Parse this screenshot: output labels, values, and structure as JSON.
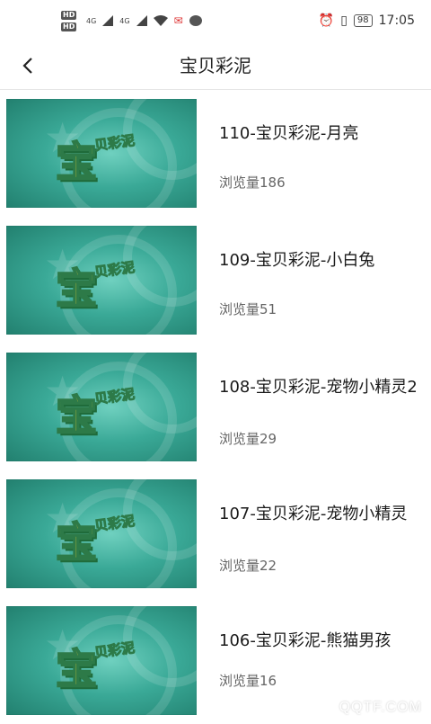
{
  "status_bar": {
    "hd1": "HD",
    "hd2": "HD",
    "net1": "4G",
    "net2": "4G",
    "battery": "98",
    "time": "17:05"
  },
  "header": {
    "title": "宝贝彩泥"
  },
  "thumbnail": {
    "logo_main": "宝",
    "logo_sub": "贝彩泥"
  },
  "items": [
    {
      "title": "110-宝贝彩泥-月亮",
      "views": "浏览量186"
    },
    {
      "title": "109-宝贝彩泥-小白兔",
      "views": "浏览量51"
    },
    {
      "title": "108-宝贝彩泥-宠物小精灵2",
      "views": "浏览量29"
    },
    {
      "title": "107-宝贝彩泥-宠物小精灵",
      "views": "浏览量22"
    },
    {
      "title": "106-宝贝彩泥-熊猫男孩",
      "views": "浏览量16"
    }
  ],
  "watermark": "QQTF.COM"
}
